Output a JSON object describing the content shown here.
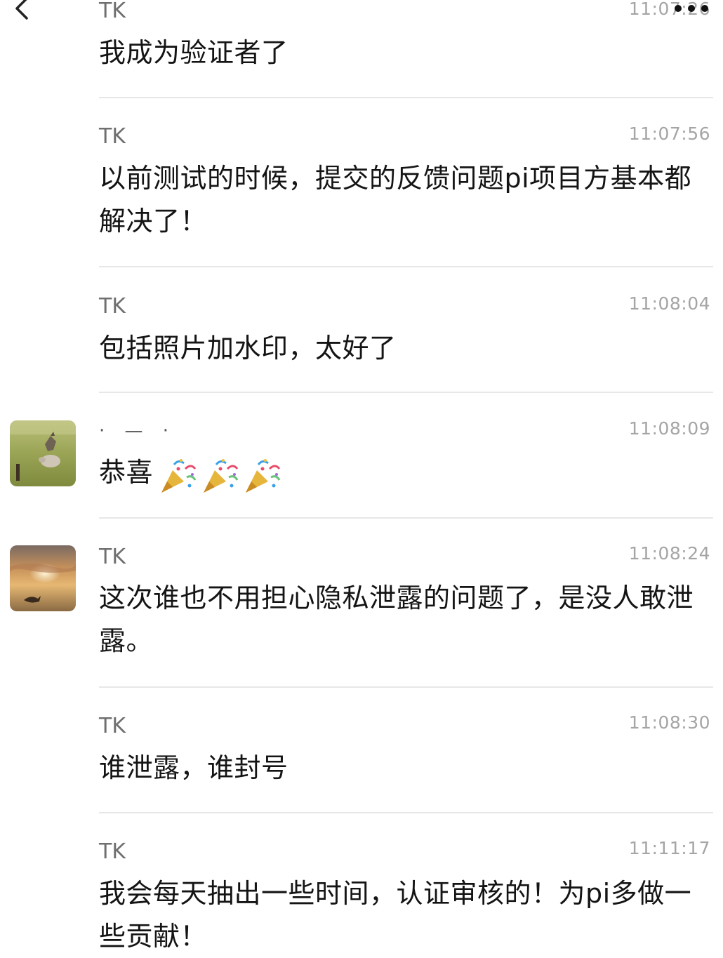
{
  "messages": [
    {
      "sender": "TK",
      "time": "11:07:26",
      "text": "我成为验证者了"
    },
    {
      "sender": "TK",
      "time": "11:07:56",
      "text": "以前测试的时候，提交的反馈问题pi项目方基本都解决了！"
    },
    {
      "sender": "TK",
      "time": "11:08:04",
      "text": "包括照片加水印，太好了"
    },
    {
      "sender": "· — ·",
      "time": "11:08:09",
      "text": "恭喜",
      "emoji_count": 3,
      "emoji": "party-popper-icon",
      "avatar": "dog-and-pig-photo"
    },
    {
      "sender": "TK",
      "time": "11:08:24",
      "text": "这次谁也不用担心隐私泄露的问题了，是没人敢泄露。",
      "avatar": "sunset-whale-photo"
    },
    {
      "sender": "TK",
      "time": "11:08:30",
      "text": "谁泄露，谁封号"
    },
    {
      "sender": "TK",
      "time": "11:11:17",
      "text": "我会每天抽出一些时间，认证审核的！为pi多做一些贡献！"
    }
  ],
  "icons": {
    "back": "chevron-left-icon",
    "more": "more-dots-icon"
  },
  "colors": {
    "sender": "#6f6f6f",
    "time": "#a5a5a5",
    "text": "#141414",
    "separator": "#e7e7e7"
  }
}
